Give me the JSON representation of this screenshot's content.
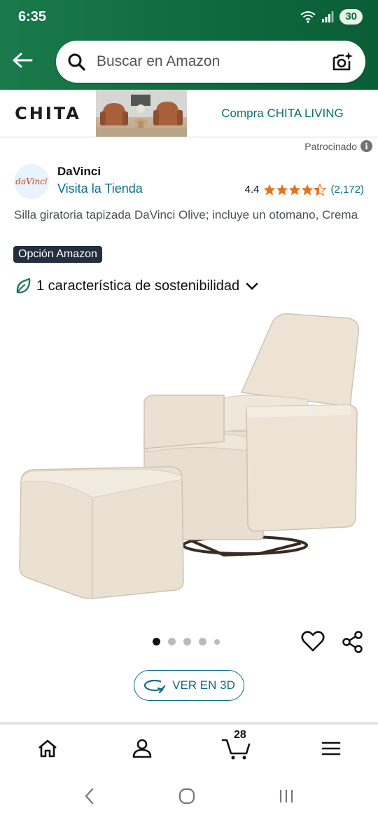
{
  "status_bar": {
    "time": "6:35",
    "battery": "30",
    "network": "6"
  },
  "header": {
    "search_placeholder": "Buscar en Amazon",
    "theme_color": "#0f6a3e"
  },
  "banner": {
    "brand_logo_text": "CHITA",
    "cta": "Compra CHITA LIVING",
    "sponsored_label": "Patrocinado"
  },
  "product": {
    "brand_logo_text": "daVinci",
    "brand": "DaVinci",
    "visit_store": "Visita la Tienda",
    "rating": "4.4",
    "stars": 4.4,
    "review_count": "(2,172)",
    "title": "Silla giratoria tapizada DaVinci Olive; incluye un otomano, Crema",
    "badge": "Opción Amazon",
    "sustainability": "1 característica de sostenibilidad",
    "image_count": 5,
    "active_image": 1,
    "view_3d": "VER EN 3D"
  },
  "bottom_nav": {
    "items": [
      {
        "icon": "home-icon"
      },
      {
        "icon": "account-icon"
      },
      {
        "icon": "cart-icon",
        "badge": "28"
      },
      {
        "icon": "menu-icon"
      }
    ]
  },
  "colors": {
    "link": "#0a6d8a",
    "star": "#e7711b",
    "badge_bg": "#232f3e"
  }
}
